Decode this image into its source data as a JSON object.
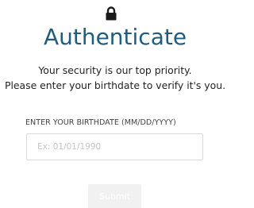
{
  "header": {
    "icon": "lock-icon",
    "title": "Authenticate",
    "line1": "Your security is our top priority.",
    "line2": "Please enter your birthdate to verify it's you."
  },
  "form": {
    "birthdate_label": "ENTER YOUR BIRTHDATE (MM/DD/YYYY)",
    "birthdate_value": "",
    "birthdate_placeholder": "Ex: 01/01/1990",
    "submit_label": "Submit"
  },
  "colors": {
    "title": "#1f5d7e",
    "icon": "#1a1a1a",
    "submit_bg": "#f1f1f1",
    "input_border": "#d9d9d9"
  }
}
